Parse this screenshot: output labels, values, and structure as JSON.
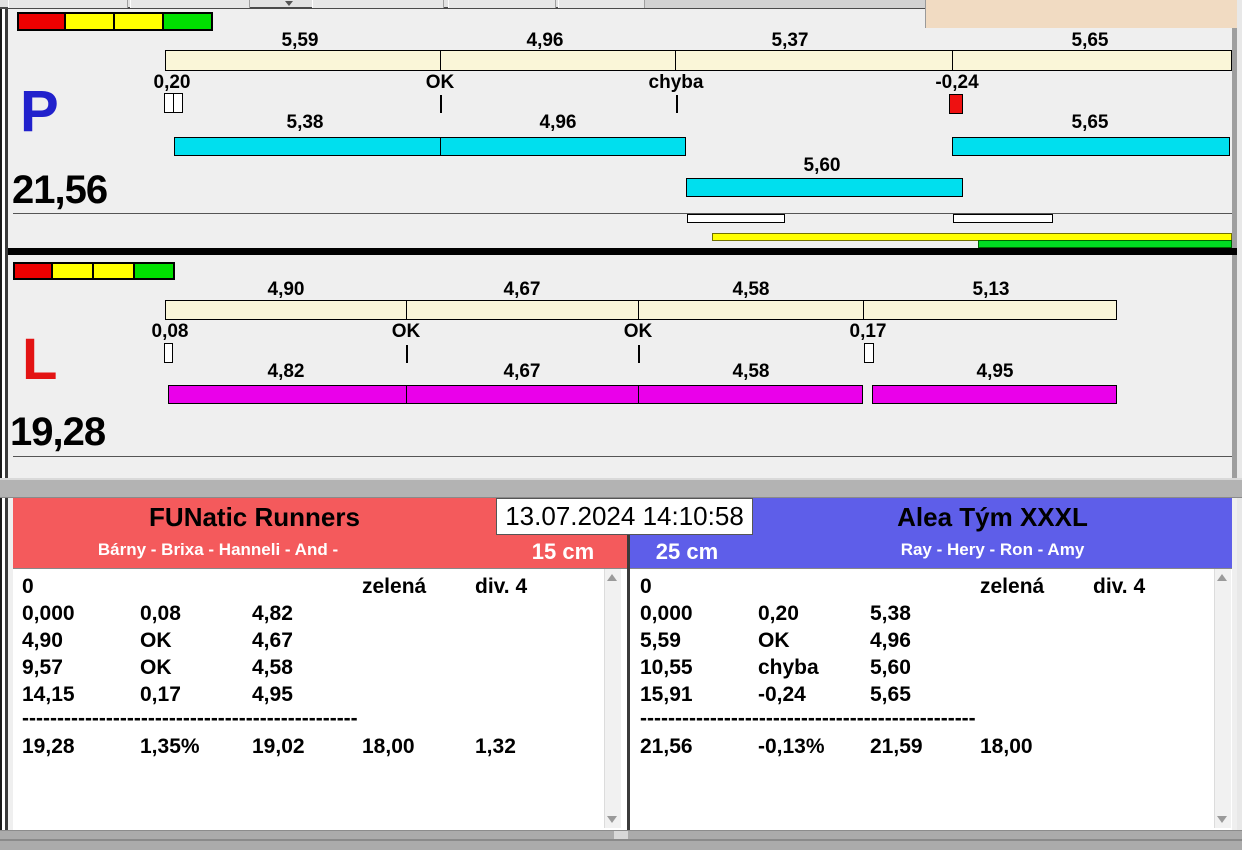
{
  "datetime": "13.07.2024 14:10:58",
  "status_lights": [
    "red",
    "yellow",
    "yellow",
    "green"
  ],
  "lanes": {
    "p": {
      "label": "P",
      "total": "21,56",
      "upper": [
        "5,59",
        "4,96",
        "5,37",
        "5,65"
      ],
      "status": [
        "0,20",
        "OK",
        "chyba",
        "-0,24"
      ],
      "lower": [
        "5,38",
        "4,96",
        "5,60",
        "5,65"
      ]
    },
    "l": {
      "label": "L",
      "total": "19,28",
      "upper": [
        "4,90",
        "4,67",
        "4,58",
        "5,13"
      ],
      "status": [
        "0,08",
        "OK",
        "OK",
        "0,17"
      ],
      "lower": [
        "4,82",
        "4,67",
        "4,58",
        "4,95"
      ]
    }
  },
  "teams": {
    "left": {
      "name": "FUNatic Runners",
      "members": "Bárny - Brixa - Hanneli - And -",
      "hurdle_height": "15 cm",
      "table": {
        "start": "0",
        "color_label": "zelená",
        "division": "div. 4",
        "rows": [
          [
            "0,000",
            "0,08",
            "4,82"
          ],
          [
            "4,90",
            "OK",
            "4,67"
          ],
          [
            "9,57",
            "OK",
            "4,58"
          ],
          [
            "14,15",
            "0,17",
            "4,95"
          ]
        ],
        "separator": "------------------------------------------------",
        "summary": [
          "19,28",
          "1,35%",
          "19,02",
          "18,00",
          "1,32"
        ]
      }
    },
    "right": {
      "name": "Alea Tým XXXL",
      "members": "Ray - Hery - Ron - Amy",
      "hurdle_height": "25 cm",
      "table": {
        "start": "0",
        "color_label": "zelená",
        "division": "div. 4",
        "rows": [
          [
            "0,000",
            "0,20",
            "5,38"
          ],
          [
            "5,59",
            "OK",
            "4,96"
          ],
          [
            "10,55",
            "chyba",
            "5,60"
          ],
          [
            "15,91",
            "-0,24",
            "5,65"
          ]
        ],
        "separator": "------------------------------------------------",
        "summary": [
          "21,56",
          "-0,13%",
          "21,59",
          "18,00"
        ]
      }
    }
  },
  "colors": {
    "team_left_accent": "#f45a5c",
    "team_right_accent": "#5e5ee9",
    "lane_p_letter": "#2121cc",
    "lane_l_letter": "#e31313",
    "upper_bar_fill": "#faf6d8",
    "lane_p_bar_fill": "#00dfee",
    "lane_l_bar_fill": "#ea00ea",
    "status_light_colors": [
      "#ee0000",
      "#ffff00",
      "#ffff00",
      "#00e000"
    ]
  }
}
